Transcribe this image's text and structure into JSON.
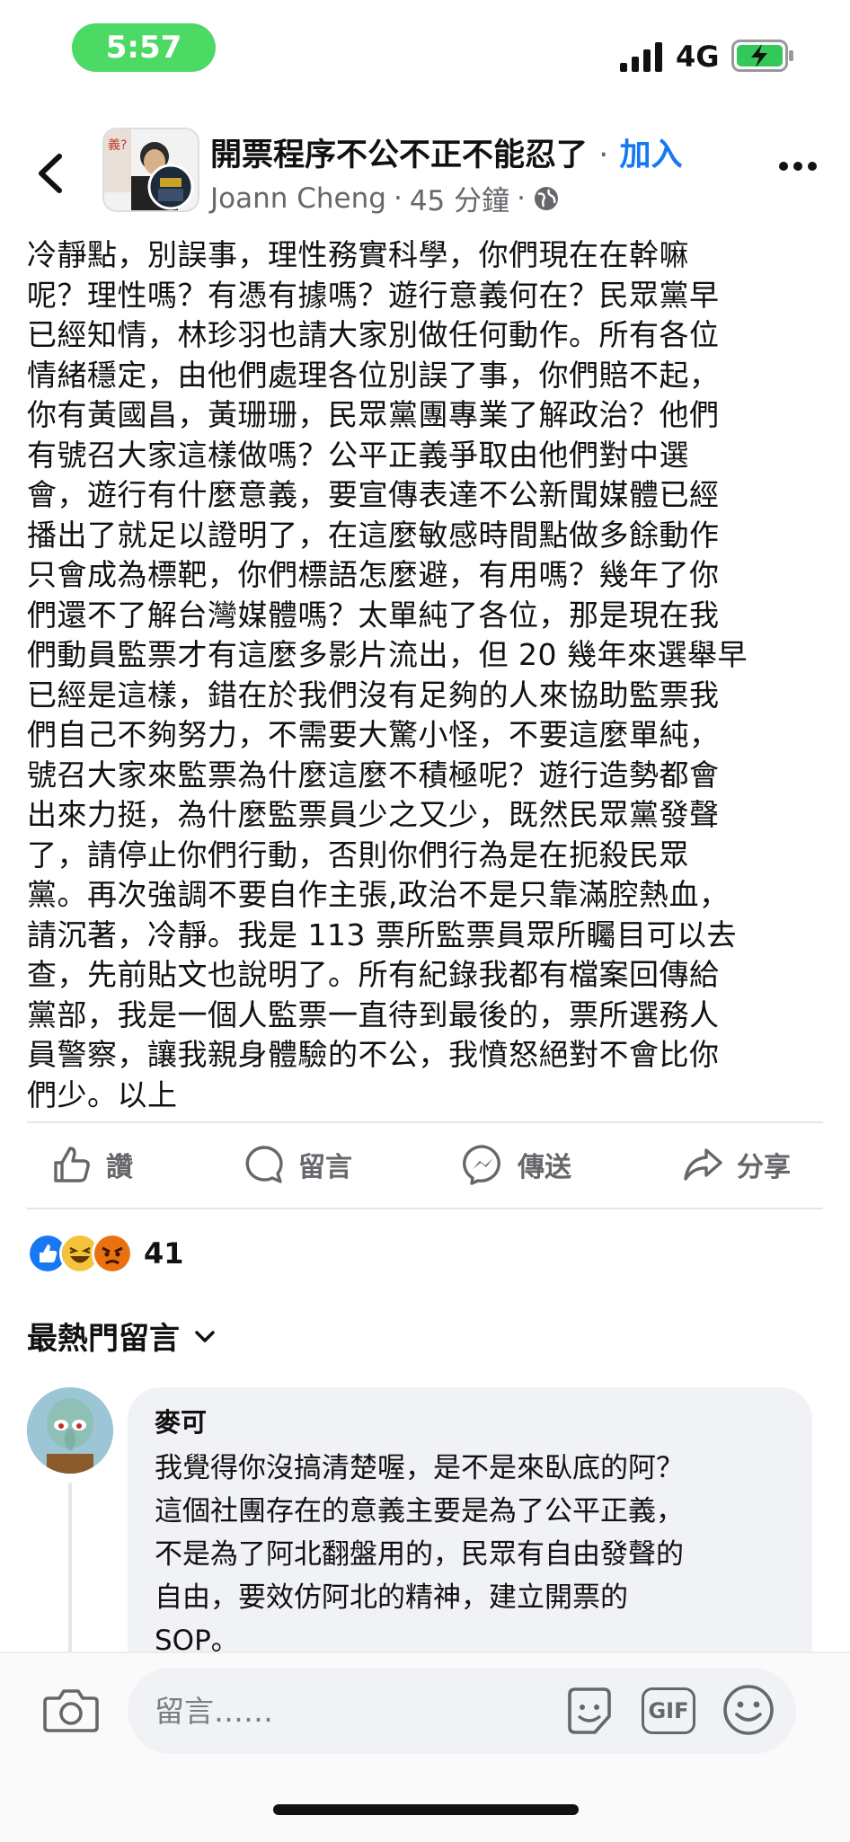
{
  "status_bar": {
    "time": "5:57",
    "network": "4G"
  },
  "header": {
    "group_name": "開票程序不公不正不能忍了",
    "separator": "·",
    "join_label": "加入",
    "author": "Joann Cheng",
    "time_ago": "45 分鐘"
  },
  "post": {
    "lines": [
      "冷靜點，別誤事，理性務實科學，你們現在在幹嘛",
      "呢？理性嗎？有憑有據嗎？遊行意義何在？民眾黨早",
      "已經知情，林珍羽也請大家別做任何動作。所有各位",
      "情緒穩定，由他們處理各位別誤了事，你們賠不起，",
      "你有黃國昌，黃珊珊，民眾黨團專業了解政治？他們",
      "有號召大家這樣做嗎？公平正義爭取由他們對中選",
      "會，遊行有什麼意義，要宣傳表達不公新聞媒體已經",
      "播出了就足以證明了，在這麼敏感時間點做多餘動作",
      "只會成為標靶，你們標語怎麼避，有用嗎？幾年了你",
      "們還不了解台灣媒體嗎？太單純了各位，那是現在我",
      "們動員監票才有這麼多影片流出，但 20 幾年來選舉早",
      "已經是這樣，錯在於我們沒有足夠的人來協助監票我",
      "們自己不夠努力，不需要大驚小怪，不要這麼單純，",
      "號召大家來監票為什麼這麼不積極呢？遊行造勢都會",
      "出來力挺，為什麼監票員少之又少，既然民眾黨發聲",
      "了，請停止你們行動，否則你們行為是在扼殺民眾",
      "黨。再次強調不要自作主張,政治不是只靠滿腔熱血，",
      "請沉著，冷靜。我是 113 票所監票員眾所矚目可以去",
      "查，先前貼文也說明了。所有紀錄我都有檔案回傳給",
      "黨部，我是一個人監票一直待到最後的，票所選務人",
      "員警察，讓我親身體驗的不公，我憤怒絕對不會比你",
      "們少。以上"
    ]
  },
  "actions": {
    "like": "讚",
    "comment": "留言",
    "send": "傳送",
    "share": "分享"
  },
  "reactions": {
    "count": "41"
  },
  "comments_section": {
    "sort_label": "最熱門留言"
  },
  "comment": {
    "name": "麥可",
    "lines": [
      "我覺得你沒搞清楚喔，是不是來臥底的阿？",
      "這個社團存在的意義主要是為了公平正義，",
      "不是為了阿北翻盤用的，民眾有自由發聲的",
      "自由，要效仿阿北的精神，建立開票的",
      "SOP。"
    ]
  },
  "composer": {
    "placeholder": "留言……",
    "gif_label": "GIF"
  },
  "colors": {
    "accent": "#1877f2",
    "time_pill": "#4cd964",
    "bubble": "#f0f2f5"
  }
}
